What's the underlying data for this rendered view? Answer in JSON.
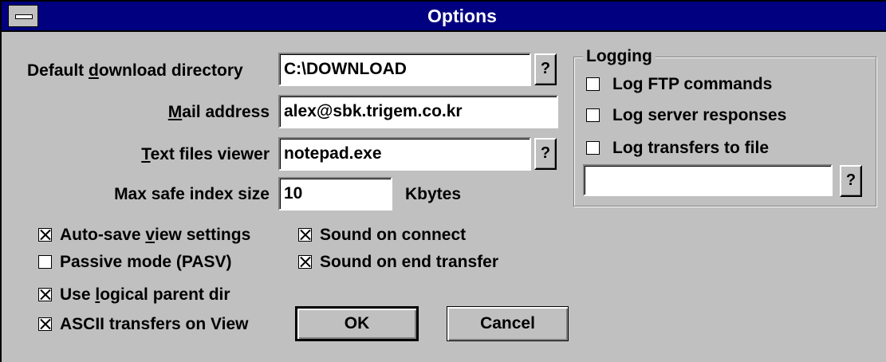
{
  "window": {
    "title": "Options"
  },
  "fields": {
    "download_dir": {
      "label": "Default download directory",
      "value": "C:\\DOWNLOAD",
      "browse": "?"
    },
    "mail": {
      "label": "Mail address",
      "value": "alex@sbk.trigem.co.kr"
    },
    "viewer": {
      "label": "Text files viewer",
      "value": "notepad.exe",
      "browse": "?"
    },
    "max_index": {
      "label": "Max safe index size",
      "value": "10",
      "unit": "Kbytes"
    }
  },
  "checkboxes": {
    "auto_save": {
      "label": "Auto-save view settings",
      "checked": true
    },
    "passive": {
      "label": "Passive mode (PASV)",
      "checked": false
    },
    "logical_parent": {
      "label": "Use logical parent dir",
      "checked": true
    },
    "ascii_view": {
      "label": "ASCII transfers on View",
      "checked": true
    },
    "sound_connect": {
      "label": "Sound on connect",
      "checked": true
    },
    "sound_end": {
      "label": "Sound on end transfer",
      "checked": true
    }
  },
  "logging": {
    "title": "Logging",
    "log_ftp": {
      "label": "Log FTP commands",
      "checked": false
    },
    "log_server": {
      "label": "Log server responses",
      "checked": false
    },
    "log_file": {
      "label": "Log transfers to file",
      "checked": false
    },
    "file_value": "",
    "browse": "?"
  },
  "buttons": {
    "ok": "OK",
    "cancel": "Cancel"
  }
}
